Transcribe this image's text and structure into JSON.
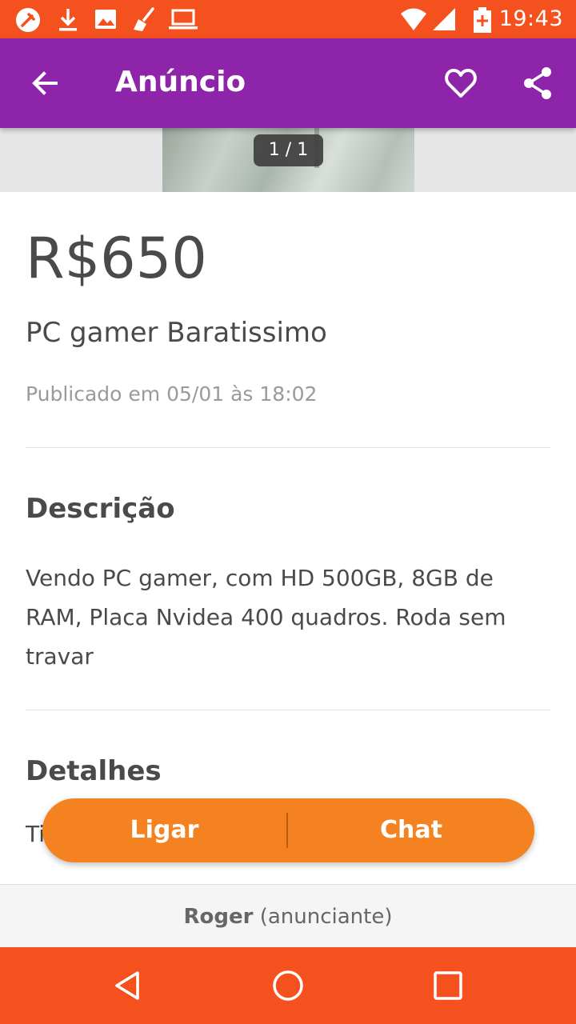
{
  "status_bar": {
    "time": "19:43",
    "icons": [
      "tool-icon",
      "download-icon",
      "image-icon",
      "broom-icon",
      "laptop-icon",
      "wifi-icon",
      "signal-icon",
      "battery-icon"
    ]
  },
  "app_bar": {
    "title": "Anúncio",
    "icons": [
      "back-arrow-icon",
      "heart-icon",
      "share-icon"
    ]
  },
  "gallery": {
    "counter": "1 / 1"
  },
  "listing": {
    "price": "R$650",
    "title": "PC gamer Baratissimo",
    "published": "Publicado em 05/01 às 18:02"
  },
  "description": {
    "heading": "Descrição",
    "text": "Vendo PC gamer, com HD 500GB, 8GB de RAM, Placa Nvidea 400 quadros. Roda sem travar"
  },
  "details": {
    "heading": "Detalhes",
    "first_row_peek": "Ti"
  },
  "actions": {
    "call_label": "Ligar",
    "chat_label": "Chat"
  },
  "seller": {
    "name": "Roger",
    "role": "(anunciante)"
  },
  "nav_bar": {
    "icons": [
      "back-triangle-icon",
      "home-circle-icon",
      "recents-square-icon"
    ]
  },
  "colors": {
    "status_bar": "#f4511e",
    "app_bar": "#8e24aa",
    "action_button": "#f58220",
    "nav_bar": "#f4511e"
  }
}
